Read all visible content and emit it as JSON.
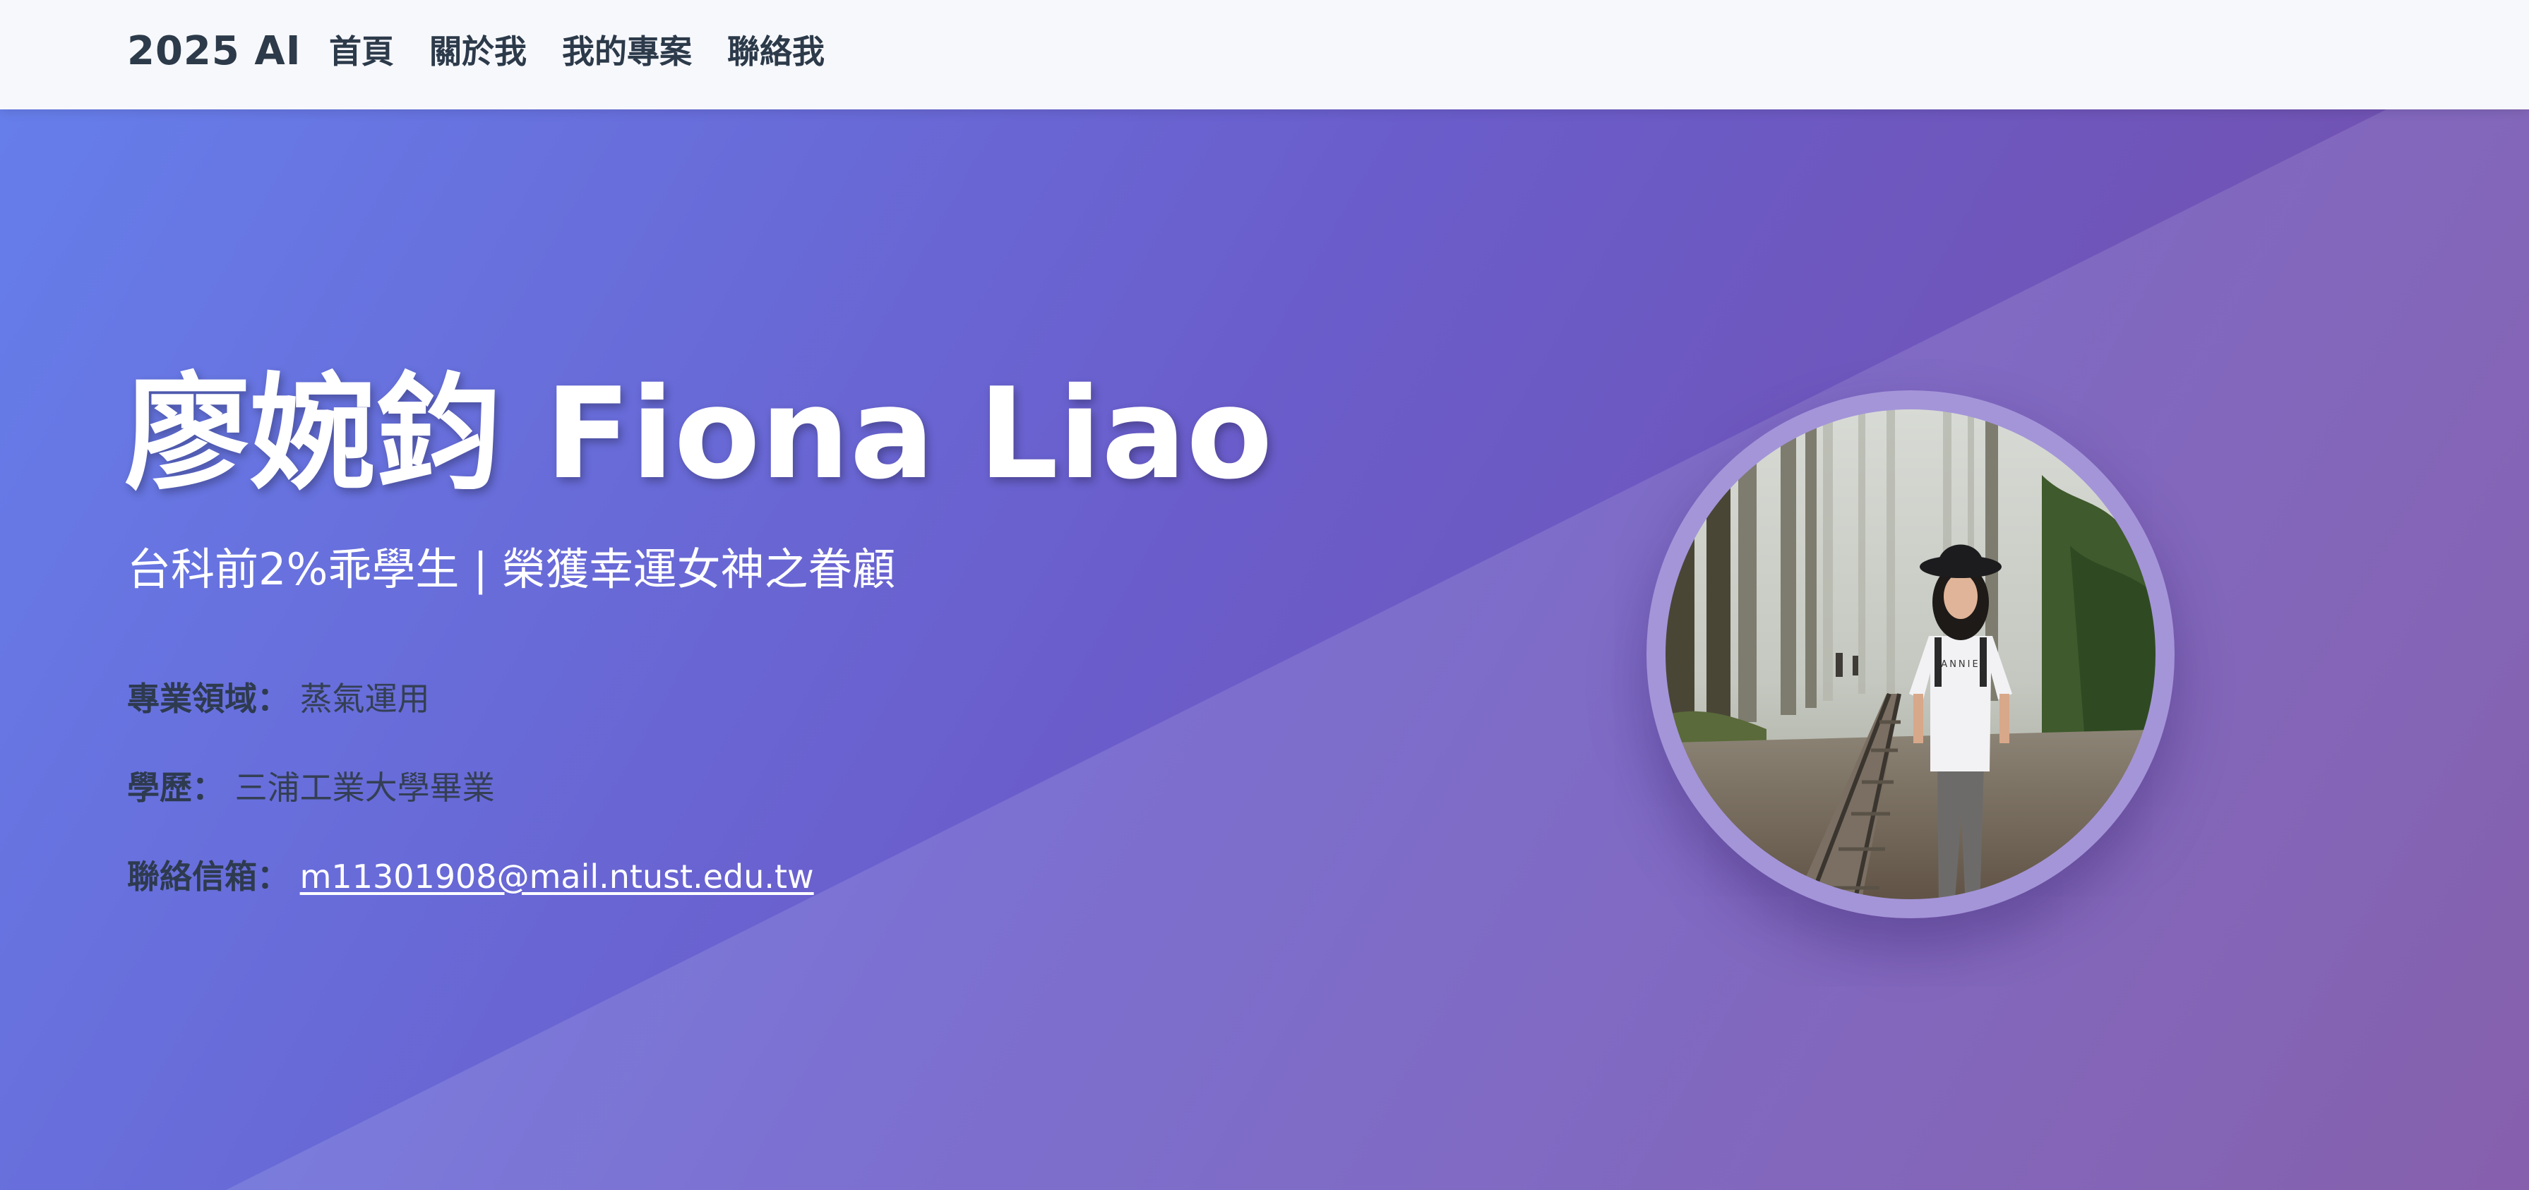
{
  "navbar": {
    "brand": "2025 AI",
    "links": [
      "首頁",
      "關於我",
      "我的專案",
      "聯絡我"
    ]
  },
  "hero": {
    "title": "廖婉鈞 Fiona Liao",
    "subtitle": "台科前2%乖學生 | 榮獲幸運女神之眷顧",
    "field": {
      "label": "專業領域：",
      "value": "蒸氣運用"
    },
    "education": {
      "label": "學歷：",
      "value": "三浦工業大學畢業"
    },
    "email": {
      "label": "聯絡信箱：",
      "value": "m11301908@mail.ntust.edu.tw"
    }
  },
  "photo": {
    "subject": "person-on-railway-in-misty-forest",
    "shirt_text": "ANNIE"
  },
  "colors": {
    "navbar_bg": "#f7f8fc",
    "nav_text": "#2c3a4a",
    "hero_gradient_start": "#667eea",
    "hero_gradient_mid": "#6a5dcb",
    "hero_gradient_end": "#764ba2",
    "avatar_border": "#a495d9",
    "label_text": "#2e3a4f"
  }
}
